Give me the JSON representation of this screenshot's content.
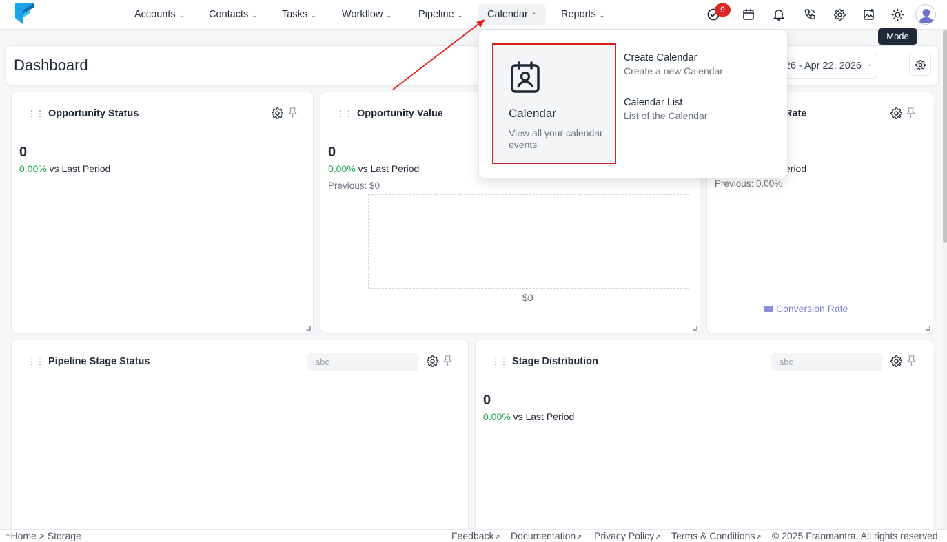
{
  "nav": {
    "items": [
      {
        "label": "Accounts",
        "name": "nav-accounts"
      },
      {
        "label": "Contacts",
        "name": "nav-contacts"
      },
      {
        "label": "Tasks",
        "name": "nav-tasks"
      },
      {
        "label": "Workflow",
        "name": "nav-workflow"
      },
      {
        "label": "Pipeline",
        "name": "nav-pipeline"
      },
      {
        "label": "Calendar",
        "name": "nav-calendar"
      },
      {
        "label": "Reports",
        "name": "nav-reports"
      }
    ],
    "tasks_badge": "9",
    "tooltip": "Mode",
    "icons": [
      "task-check-icon",
      "calendar-icon",
      "bell-icon",
      "phone-icon",
      "gear-icon",
      "image-icon",
      "sun-icon",
      "avatar"
    ]
  },
  "header": {
    "title": "Dashboard",
    "date_range": "Apr 22, 2026 - Apr 22, 2026"
  },
  "widgets": {
    "opp_status": {
      "title": "Opportunity Status",
      "value": "0",
      "pct": "0.00%",
      "vs": "vs Last Period"
    },
    "opp_value": {
      "title": "Opportunity Value",
      "value": "0",
      "pct": "0.00%",
      "vs": "vs Last Period",
      "previous": "Previous: $0",
      "x_tick": "$0"
    },
    "conv_rate": {
      "title_visible": "Rate",
      "vs_visible": "eriod",
      "previous": "Previous: 0.00%",
      "legend": "Conversion Rate"
    },
    "pipeline_stage": {
      "title": "Pipeline Stage Status",
      "select": "abc"
    },
    "stage_dist": {
      "title": "Stage Distribution",
      "select": "abc",
      "value": "0",
      "pct": "0.00%",
      "vs": "vs Last Period"
    }
  },
  "dropdown": {
    "featured": {
      "title": "Calendar",
      "desc": "View all your calendar events"
    },
    "links": [
      {
        "title": "Create Calendar",
        "desc": "Create a new Calendar"
      },
      {
        "title": "Calendar List",
        "desc": "List of the Calendar"
      }
    ]
  },
  "footer": {
    "breadcrumb_home": "Home",
    "breadcrumb_sep": ">",
    "breadcrumb_current": "Storage",
    "links": [
      "Feedback",
      "Documentation",
      "Privacy Policy",
      "Terms & Conditions"
    ],
    "copyright": "© 2025 Franmantra. All rights reserved."
  },
  "colors": {
    "accent_red": "#dc2626",
    "positive": "#16a34a",
    "legend": "#8b8fdc",
    "logo": "#1aa3e8"
  }
}
